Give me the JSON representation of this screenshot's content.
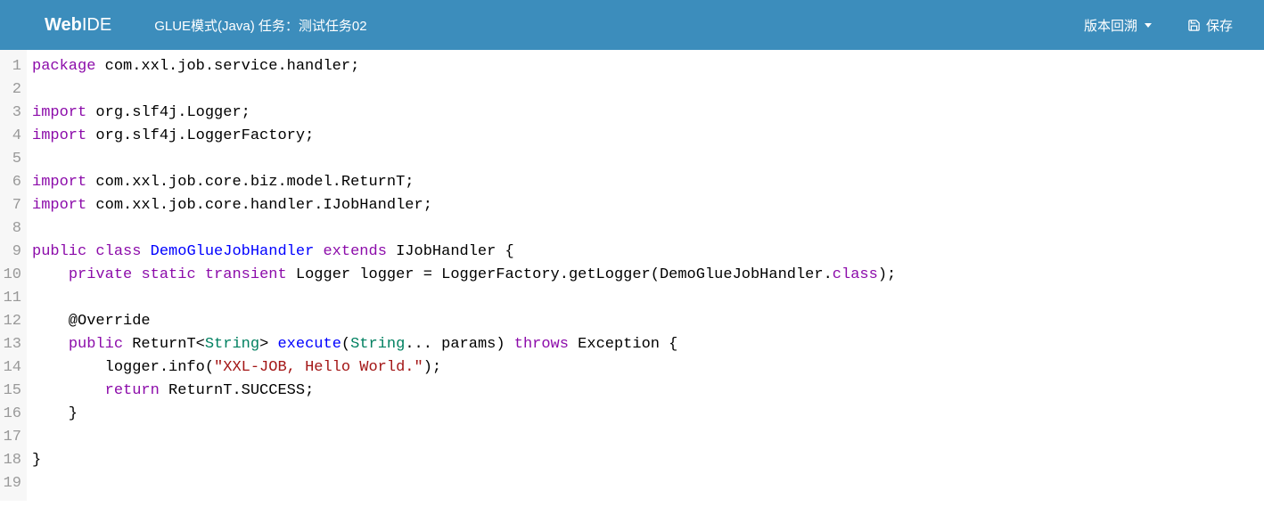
{
  "navbar": {
    "brand_bold": "Web",
    "brand_light": "IDE",
    "mode_info": "GLUE模式(Java) 任务：测试任务02",
    "version_btn": "版本回溯",
    "save_btn": "保存"
  },
  "editor": {
    "line_count": 19,
    "tokens": [
      [
        {
          "t": "package",
          "c": "kw"
        },
        {
          "t": " "
        },
        {
          "t": "com.xxl.job.service.handler"
        },
        {
          "t": ";"
        }
      ],
      [],
      [
        {
          "t": "import",
          "c": "kw"
        },
        {
          "t": " "
        },
        {
          "t": "org.slf4j.Logger"
        },
        {
          "t": ";"
        }
      ],
      [
        {
          "t": "import",
          "c": "kw"
        },
        {
          "t": " "
        },
        {
          "t": "org.slf4j.LoggerFactory"
        },
        {
          "t": ";"
        }
      ],
      [],
      [
        {
          "t": "import",
          "c": "kw"
        },
        {
          "t": " "
        },
        {
          "t": "com.xxl.job.core.biz.model.ReturnT"
        },
        {
          "t": ";"
        }
      ],
      [
        {
          "t": "import",
          "c": "kw"
        },
        {
          "t": " "
        },
        {
          "t": "com.xxl.job.core.handler.IJobHandler"
        },
        {
          "t": ";"
        }
      ],
      [],
      [
        {
          "t": "public",
          "c": "kw"
        },
        {
          "t": " "
        },
        {
          "t": "class",
          "c": "kw"
        },
        {
          "t": " "
        },
        {
          "t": "DemoGlueJobHandler",
          "c": "def"
        },
        {
          "t": " "
        },
        {
          "t": "extends",
          "c": "kw"
        },
        {
          "t": " "
        },
        {
          "t": "IJobHandler"
        },
        {
          "t": " {"
        }
      ],
      [
        {
          "t": "    "
        },
        {
          "t": "private",
          "c": "kw"
        },
        {
          "t": " "
        },
        {
          "t": "static",
          "c": "kw"
        },
        {
          "t": " "
        },
        {
          "t": "transient",
          "c": "kw"
        },
        {
          "t": " "
        },
        {
          "t": "Logger logger = LoggerFactory.getLogger(DemoGlueJobHandler."
        },
        {
          "t": "class",
          "c": "kw"
        },
        {
          "t": ");"
        }
      ],
      [],
      [
        {
          "t": "    @Override"
        }
      ],
      [
        {
          "t": "    "
        },
        {
          "t": "public",
          "c": "kw"
        },
        {
          "t": " "
        },
        {
          "t": "ReturnT"
        },
        {
          "t": "<"
        },
        {
          "t": "String",
          "c": "type"
        },
        {
          "t": "> "
        },
        {
          "t": "execute",
          "c": "def"
        },
        {
          "t": "("
        },
        {
          "t": "String",
          "c": "type"
        },
        {
          "t": "... params) "
        },
        {
          "t": "throws",
          "c": "kw"
        },
        {
          "t": " Exception {"
        }
      ],
      [
        {
          "t": "        logger.info("
        },
        {
          "t": "\"XXL-JOB, Hello World.\"",
          "c": "str"
        },
        {
          "t": ");"
        }
      ],
      [
        {
          "t": "        "
        },
        {
          "t": "return",
          "c": "kw"
        },
        {
          "t": " ReturnT.SUCCESS;"
        }
      ],
      [
        {
          "t": "    }"
        }
      ],
      [],
      [
        {
          "t": "}"
        }
      ],
      []
    ]
  }
}
